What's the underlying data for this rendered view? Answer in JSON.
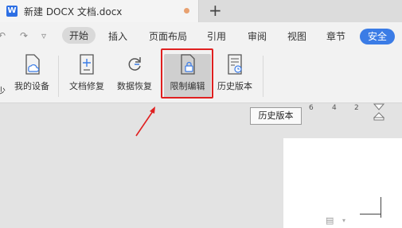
{
  "tab": {
    "icon_letter": "W",
    "title": "新建 DOCX 文档.docx",
    "add_label": "+"
  },
  "quick_access": {
    "undo": "↶",
    "redo": "↷",
    "more": "▿"
  },
  "menu": {
    "items": [
      "开始",
      "插入",
      "页面布局",
      "引用",
      "审阅",
      "视图",
      "章节"
    ],
    "active": "开始",
    "security": "安全"
  },
  "toolbar": {
    "left_partial": "少",
    "tools": [
      {
        "label": "我的设备",
        "icon": "cloud-device-icon"
      },
      {
        "label": "文档修复",
        "icon": "doc-repair-icon"
      },
      {
        "label": "数据恢复",
        "icon": "data-recovery-icon"
      },
      {
        "label": "限制编辑",
        "icon": "restrict-edit-icon"
      },
      {
        "label": "历史版本",
        "icon": "history-version-icon"
      }
    ],
    "selected": "限制编辑"
  },
  "tooltip": {
    "text": "历史版本"
  },
  "ruler": {
    "numbers": [
      "6",
      "4",
      "2"
    ]
  },
  "colors": {
    "accent": "#3b7ce6",
    "highlight": "#e02020",
    "modified_dot": "#e8a170"
  }
}
